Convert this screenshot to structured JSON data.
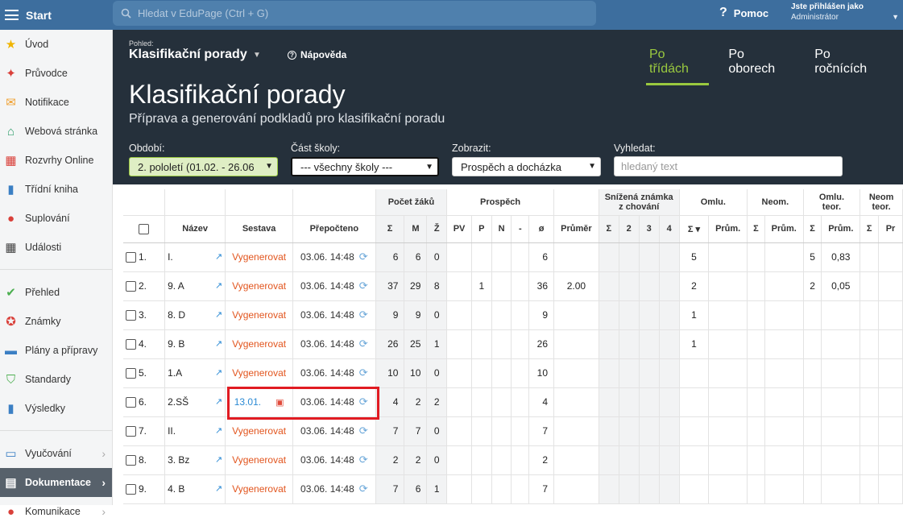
{
  "topbar": {
    "start_label": "Start",
    "search_placeholder": "Hledat v EduPage (Ctrl + G)",
    "help_label": "Pomoc",
    "login_line1": "Jste přihlášen jako",
    "login_line2": "Administrátor"
  },
  "sidebar": {
    "items": [
      {
        "label": "Úvod",
        "icon": "star-icon",
        "color": "#f0b400"
      },
      {
        "label": "Průvodce",
        "icon": "wand-icon",
        "color": "#d9403a"
      },
      {
        "label": "Notifikace",
        "icon": "envelope-icon",
        "color": "#f0a030"
      },
      {
        "label": "Webová stránka",
        "icon": "house-icon",
        "color": "#2f9e6b"
      },
      {
        "label": "Rozvrhy Online",
        "icon": "calendar-grid-icon",
        "color": "#d9403a"
      },
      {
        "label": "Třídní kniha",
        "icon": "book-icon",
        "color": "#3b7fc4"
      },
      {
        "label": "Suplování",
        "icon": "person-icon",
        "color": "#d9403a"
      },
      {
        "label": "Události",
        "icon": "calendar-icon",
        "color": "#444"
      },
      {
        "label": "Přehled",
        "icon": "check-circle-icon",
        "color": "#4caf50"
      },
      {
        "label": "Známky",
        "icon": "grade-icon",
        "color": "#d9403a"
      },
      {
        "label": "Plány a přípravy",
        "icon": "briefcase-icon",
        "color": "#3b7fc4"
      },
      {
        "label": "Standardy",
        "icon": "shield-icon",
        "color": "#4caf50"
      },
      {
        "label": "Výsledky",
        "icon": "bar-chart-icon",
        "color": "#3b7fc4"
      },
      {
        "label": "Vyučování",
        "icon": "open-book-icon",
        "color": "#3b7fc4"
      },
      {
        "label": "Dokumentace",
        "icon": "document-icon",
        "color": "#fff"
      },
      {
        "label": "Komunikace",
        "icon": "chat-icon",
        "color": "#d9403a"
      }
    ]
  },
  "header": {
    "pohled_label": "Pohled:",
    "pohled_value": "Klasifikační porady",
    "napoveda": "Nápověda",
    "tabs": [
      "Po třídách",
      "Po oborech",
      "Po ročnících"
    ],
    "title": "Klasifikační porady",
    "subtitle": "Příprava a generování podkladů pro klasifikační poradu",
    "filters": {
      "obdobi_label": "Období:",
      "obdobi_value": "2. pololetí (01.02. - 26.06",
      "cast_label": "Část školy:",
      "cast_value": "--- všechny školy ---",
      "zobrazit_label": "Zobrazit:",
      "zobrazit_value": "Prospěch a docházka",
      "vyhledat_label": "Vyhledat:",
      "vyhledat_placeholder": "hledaný text"
    }
  },
  "table": {
    "group_headers": {
      "pocet": "Počet žáků",
      "prospech": "Prospěch",
      "snizena1": "Snížená známka",
      "snizena2": "z chování",
      "omlu": "Omlu.",
      "neom": "Neom.",
      "omlu_teor1": "Omlu.",
      "omlu_teor2": "teor.",
      "neom_teor1": "Neom",
      "neom_teor2": "teor."
    },
    "columns": {
      "nazev": "Název",
      "sestava": "Sestava",
      "prepocteno": "Přepočteno",
      "sum": "Σ",
      "m": "M",
      "z": "Ž",
      "pv": "PV",
      "p": "P",
      "n": "N",
      "dash": "-",
      "avg": "ø",
      "prumer": "Průměr",
      "s_sum": "Σ",
      "s2": "2",
      "s3": "3",
      "s4": "4",
      "o_sum": "Σ ▾",
      "o_pr": "Prům.",
      "n_sum": "Σ",
      "n_pr": "Prům.",
      "ot_sum": "Σ",
      "ot_pr": "Prům.",
      "nt_sum": "Σ",
      "nt_pr": "Pr"
    },
    "rows": [
      {
        "idx": "1.",
        "nazev": "I.",
        "sestava": "Vygenerovat",
        "sestava_type": "gen",
        "prepocteno": "03.06. 14:48",
        "sum": "6",
        "m": "6",
        "z": "0",
        "p": "",
        "avg": "6",
        "prumer": "",
        "o_sum": "5",
        "ot_sum": "5",
        "ot_pr": "0,83"
      },
      {
        "idx": "2.",
        "nazev": "9. A",
        "sestava": "Vygenerovat",
        "sestava_type": "gen",
        "prepocteno": "03.06. 14:48",
        "sum": "37",
        "m": "29",
        "z": "8",
        "p": "1",
        "avg": "36",
        "prumer": "2.00",
        "o_sum": "2",
        "ot_sum": "2",
        "ot_pr": "0,05"
      },
      {
        "idx": "3.",
        "nazev": "8. D",
        "sestava": "Vygenerovat",
        "sestava_type": "gen",
        "prepocteno": "03.06. 14:48",
        "sum": "9",
        "m": "9",
        "z": "0",
        "p": "",
        "avg": "9",
        "prumer": "",
        "o_sum": "1",
        "ot_sum": "",
        "ot_pr": ""
      },
      {
        "idx": "4.",
        "nazev": "9. B",
        "sestava": "Vygenerovat",
        "sestava_type": "gen",
        "prepocteno": "03.06. 14:48",
        "sum": "26",
        "m": "25",
        "z": "1",
        "p": "",
        "avg": "26",
        "prumer": "",
        "o_sum": "1",
        "ot_sum": "",
        "ot_pr": ""
      },
      {
        "idx": "5.",
        "nazev": "1.A",
        "sestava": "Vygenerovat",
        "sestava_type": "gen",
        "prepocteno": "03.06. 14:48",
        "sum": "10",
        "m": "10",
        "z": "0",
        "p": "",
        "avg": "10",
        "prumer": "",
        "o_sum": "",
        "ot_sum": "",
        "ot_pr": ""
      },
      {
        "idx": "6.",
        "nazev": "2.SŠ",
        "sestava": "13.01.",
        "sestava_type": "link",
        "prepocteno": "03.06. 14:48",
        "sum": "4",
        "m": "2",
        "z": "2",
        "p": "",
        "avg": "4",
        "prumer": "",
        "o_sum": "",
        "ot_sum": "",
        "ot_pr": ""
      },
      {
        "idx": "7.",
        "nazev": "II.",
        "sestava": "Vygenerovat",
        "sestava_type": "gen",
        "prepocteno": "03.06. 14:48",
        "sum": "7",
        "m": "7",
        "z": "0",
        "p": "",
        "avg": "7",
        "prumer": "",
        "o_sum": "",
        "ot_sum": "",
        "ot_pr": ""
      },
      {
        "idx": "8.",
        "nazev": "3. Bz",
        "sestava": "Vygenerovat",
        "sestava_type": "gen",
        "prepocteno": "03.06. 14:48",
        "sum": "2",
        "m": "2",
        "z": "0",
        "p": "",
        "avg": "2",
        "prumer": "",
        "o_sum": "",
        "ot_sum": "",
        "ot_pr": ""
      },
      {
        "idx": "9.",
        "nazev": "4. B",
        "sestava": "Vygenerovat",
        "sestava_type": "gen",
        "prepocteno": "03.06. 14:48",
        "sum": "7",
        "m": "6",
        "z": "1",
        "p": "",
        "avg": "7",
        "prumer": "",
        "o_sum": "",
        "ot_sum": "",
        "ot_pr": ""
      }
    ]
  },
  "colors": {
    "accent_green": "#9ac93f",
    "topbar": "#3d6e9e",
    "header_bg": "#25303b",
    "generate": "#e2551e",
    "link": "#2a8ad4",
    "highlight": "#e11b22"
  }
}
